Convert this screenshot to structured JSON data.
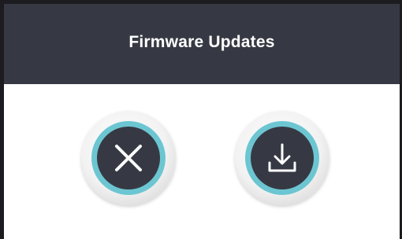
{
  "dialog": {
    "title": "Firmware Updates"
  },
  "buttons": {
    "cancel": {
      "icon": "close-icon"
    },
    "download": {
      "icon": "download-icon"
    }
  },
  "colors": {
    "header": "#363943",
    "accent_ring": "#6cc6d2",
    "icon": "#ffffff",
    "border": "#1c1c20"
  }
}
